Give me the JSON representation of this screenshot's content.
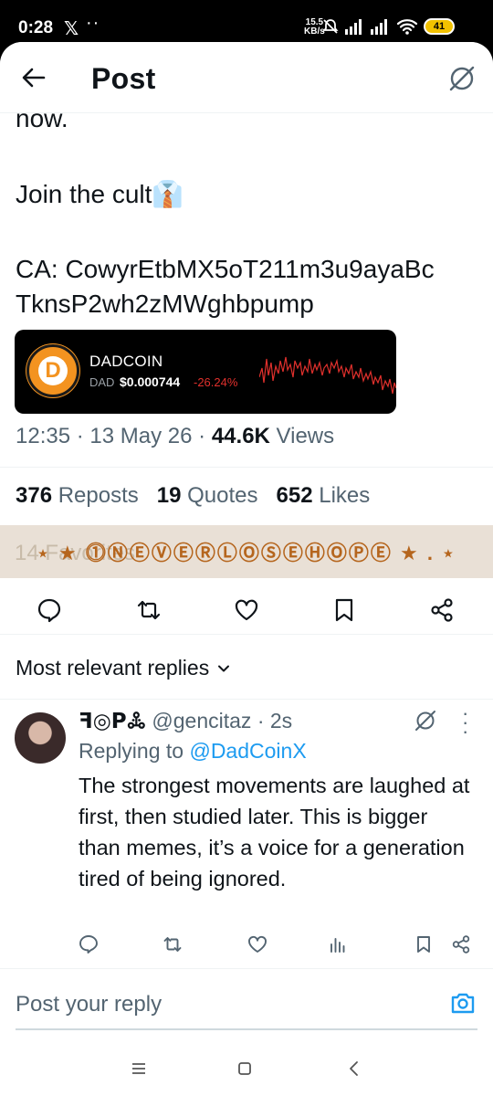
{
  "status_bar": {
    "time": "0:28",
    "x_logo": "𝕏",
    "dots": "··",
    "speed_top": "15.5",
    "speed_bottom": "KB/s",
    "battery": "41",
    "icons": [
      "mute-bell-icon",
      "signal-icon",
      "signal-icon",
      "wifi-icon",
      "battery-icon"
    ]
  },
  "header": {
    "title": "Post",
    "back_icon": "arrow-left-icon",
    "grok_icon": "grok-icon"
  },
  "post": {
    "line_now": "now.",
    "line_join": "Join the cult👔",
    "line_ca1": "CA: CowyrEtbMX5oT211m3u9ayaBc",
    "line_ca2": "TknsP2wh2zMWghbpump",
    "card": {
      "name": "DADCOIN",
      "symbol": "DAD",
      "price": "$0.000744",
      "change": "-26.24%"
    },
    "time": "12:35",
    "date": "13 May 26",
    "views_count": "44.6K",
    "views_label": "Views",
    "sep": "·",
    "reposts_count": "376",
    "reposts_label": "Reposts",
    "quotes_count": "19",
    "quotes_label": "Quotes",
    "likes_count": "652",
    "likes_label": "Likes"
  },
  "banner": {
    "ghost": "14 Favorites",
    "text": "⋆ ★ ⓵ⓃⒺⓋⒺⓇⓁⓄⓈⒺⒽⓄⓅⒺ ★ . ⋆"
  },
  "replies_filter": {
    "label": "Most relevant replies"
  },
  "reply": {
    "name": "ꟻ◎ꓑꔆ",
    "handle": "@gencitaz",
    "time": "2s",
    "replying_label": "Replying to",
    "replying_to": "@DadCoinX",
    "text": "The strongest movements are laughed at first, then studied later. This is bigger than memes, it’s a voice for a generation tired of being ignored."
  },
  "reply_bar": {
    "placeholder": "Post your reply"
  },
  "colors": {
    "accent": "#1d9bf0",
    "text": "#0f1419",
    "muted": "#536471",
    "negative": "#e0302c",
    "banner_bg": "#e9e0d6",
    "banner_text": "#b5651d"
  }
}
